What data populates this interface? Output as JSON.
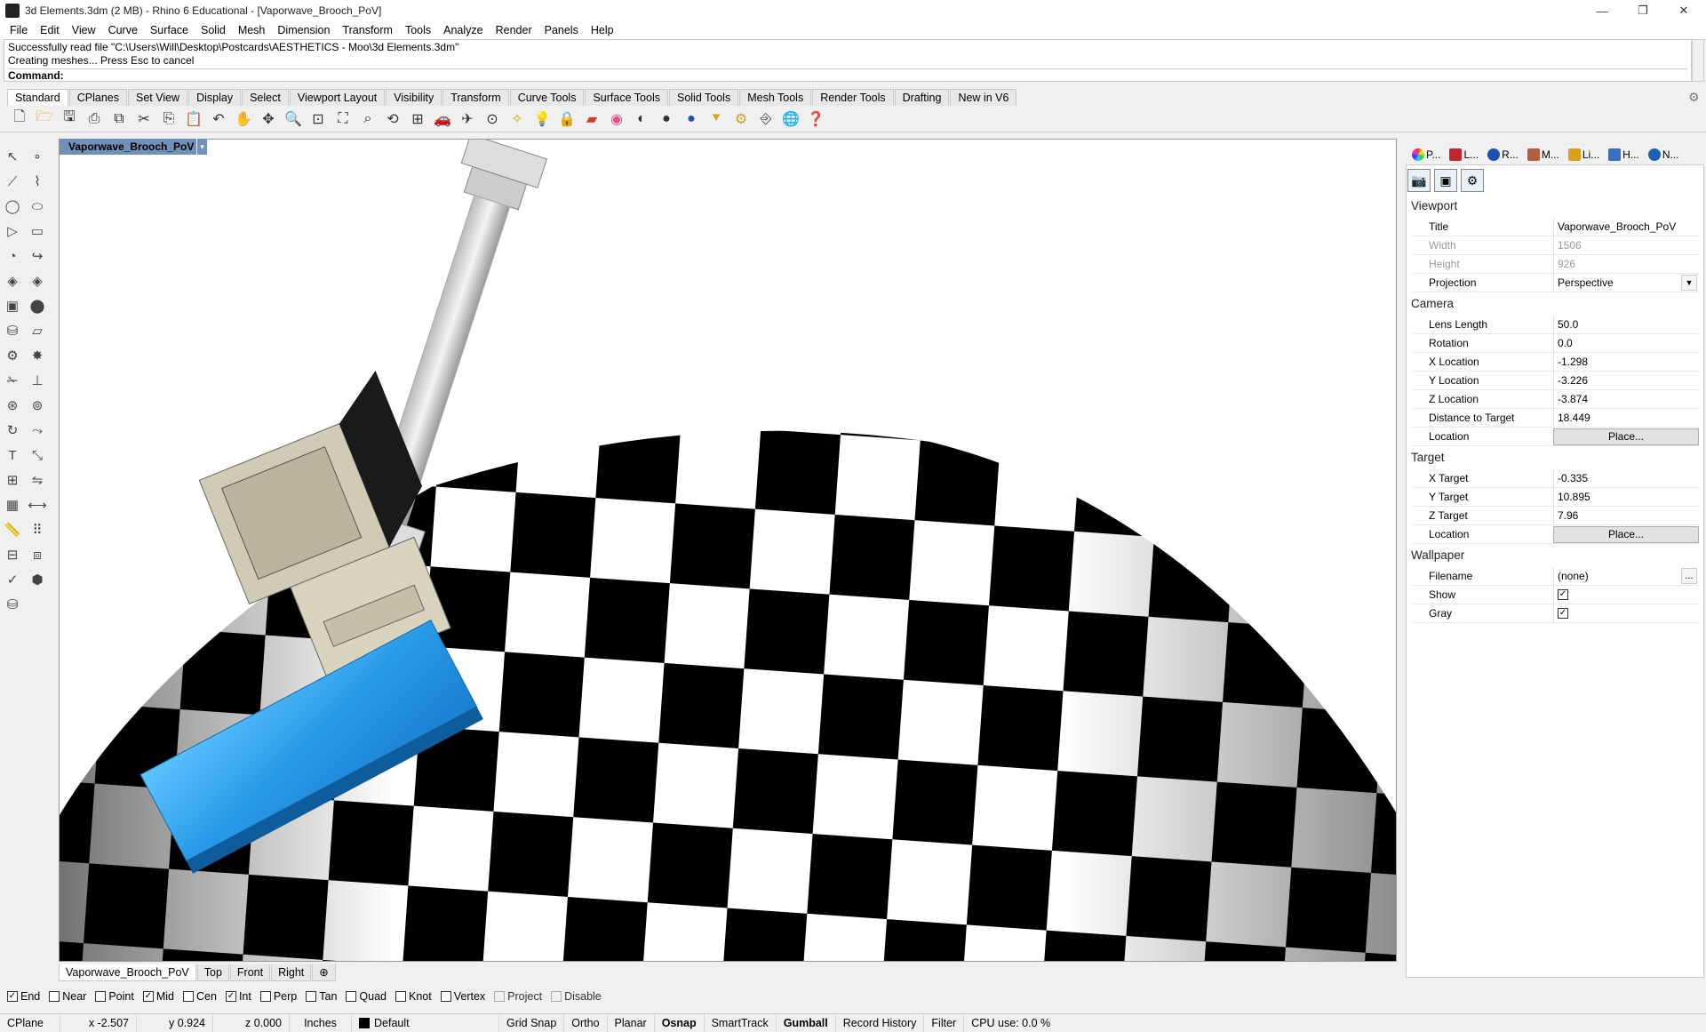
{
  "window": {
    "title": "3d Elements.3dm (2 MB) - Rhino 6 Educational - [Vaporwave_Brooch_PoV]",
    "minimize": "—",
    "restore": "❐",
    "close": "✕"
  },
  "menu": [
    "File",
    "Edit",
    "View",
    "Curve",
    "Surface",
    "Solid",
    "Mesh",
    "Dimension",
    "Transform",
    "Tools",
    "Analyze",
    "Render",
    "Panels",
    "Help"
  ],
  "command_history": {
    "line1": "Successfully read file \"C:\\Users\\Will\\Desktop\\Postcards\\AESTHETICS - Moo\\3d Elements.3dm\"",
    "line2": "Creating meshes... Press Esc to cancel",
    "prompt": "Command:"
  },
  "toolbar_tabs": [
    "Standard",
    "CPlanes",
    "Set View",
    "Display",
    "Select",
    "Viewport Layout",
    "Visibility",
    "Transform",
    "Curve Tools",
    "Surface Tools",
    "Solid Tools",
    "Mesh Tools",
    "Render Tools",
    "Drafting",
    "New in V6"
  ],
  "viewport": {
    "name": "Vaporwave_Brooch_PoV",
    "dropdown": "▾"
  },
  "viewport_tabs": [
    "Vaporwave_Brooch_PoV",
    "Top",
    "Front",
    "Right",
    "⊕"
  ],
  "osnaps": [
    {
      "label": "End",
      "checked": true
    },
    {
      "label": "Near",
      "checked": false
    },
    {
      "label": "Point",
      "checked": false
    },
    {
      "label": "Mid",
      "checked": true
    },
    {
      "label": "Cen",
      "checked": false
    },
    {
      "label": "Int",
      "checked": true
    },
    {
      "label": "Perp",
      "checked": false
    },
    {
      "label": "Tan",
      "checked": false
    },
    {
      "label": "Quad",
      "checked": false
    },
    {
      "label": "Knot",
      "checked": false
    },
    {
      "label": "Vertex",
      "checked": false
    },
    {
      "label": "Project",
      "checked": false,
      "disabled": true
    },
    {
      "label": "Disable",
      "checked": false,
      "disabled": true
    }
  ],
  "status": {
    "cplane": "CPlane",
    "x": "x -2.507",
    "y": "y 0.924",
    "z": "z 0.000",
    "units": "Inches",
    "layer": "Default",
    "grid_snap": "Grid Snap",
    "ortho": "Ortho",
    "planar": "Planar",
    "osnap": "Osnap",
    "smarttrack": "SmartTrack",
    "gumball": "Gumball",
    "record_history": "Record History",
    "filter": "Filter",
    "cpu": "CPU use: 0.0 %"
  },
  "panel_tabs": [
    "P...",
    "L...",
    "R...",
    "M...",
    "Li...",
    "H...",
    "N..."
  ],
  "properties": {
    "viewport_section": "Viewport",
    "title_label": "Title",
    "title_value": "Vaporwave_Brooch_PoV",
    "width_label": "Width",
    "width_value": "1506",
    "height_label": "Height",
    "height_value": "926",
    "projection_label": "Projection",
    "projection_value": "Perspective",
    "camera_section": "Camera",
    "lens_label": "Lens Length",
    "lens_value": "50.0",
    "rotation_label": "Rotation",
    "rotation_value": "0.0",
    "xloc_label": "X Location",
    "xloc_value": "-1.298",
    "yloc_label": "Y Location",
    "yloc_value": "-3.226",
    "zloc_label": "Z Location",
    "zloc_value": "-3.874",
    "dist_label": "Distance to Target",
    "dist_value": "18.449",
    "camloc_label": "Location",
    "place_label": "Place...",
    "target_section": "Target",
    "xt_label": "X Target",
    "xt_value": "-0.335",
    "yt_label": "Y Target",
    "yt_value": "10.895",
    "zt_label": "Z Target",
    "zt_value": "7.96",
    "tloc_label": "Location",
    "wallpaper_section": "Wallpaper",
    "filename_label": "Filename",
    "filename_value": "(none)",
    "browse": "...",
    "show_label": "Show",
    "gray_label": "Gray"
  }
}
